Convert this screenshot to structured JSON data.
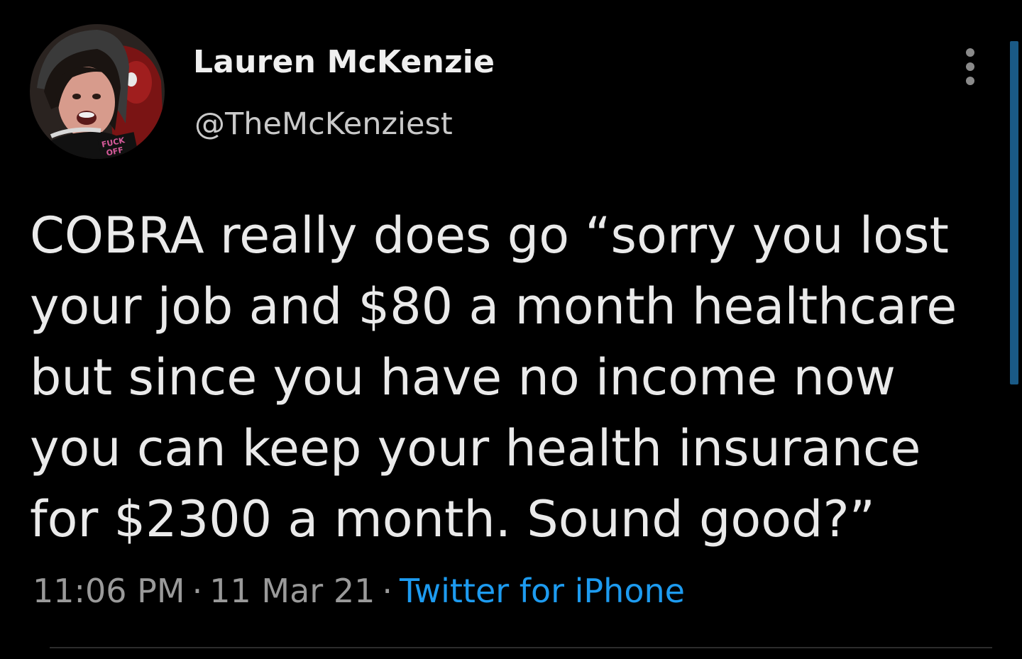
{
  "author": {
    "name": "Lauren McKenzie",
    "handle": "@TheMcKenziest",
    "avatar_shirt_text": "FUCK OFF"
  },
  "tweet": {
    "text_lines": [
      "COBRA really does go “sorry you lost",
      "your job and $80 a month healthcare",
      "but since you have no income now",
      "you can keep your health insurance",
      "for $2300 a month. Sound good?”"
    ]
  },
  "meta": {
    "time": "11:06 PM",
    "separator": "·",
    "date": "11 Mar 21",
    "source": "Twitter for iPhone"
  },
  "icons": {
    "more": "more-vertical-icon"
  },
  "colors": {
    "background": "#000000",
    "text": "#eaeaea",
    "secondary_text": "#9a9a9a",
    "link": "#1d9bf0",
    "scrollbar": "#1a5a86"
  }
}
